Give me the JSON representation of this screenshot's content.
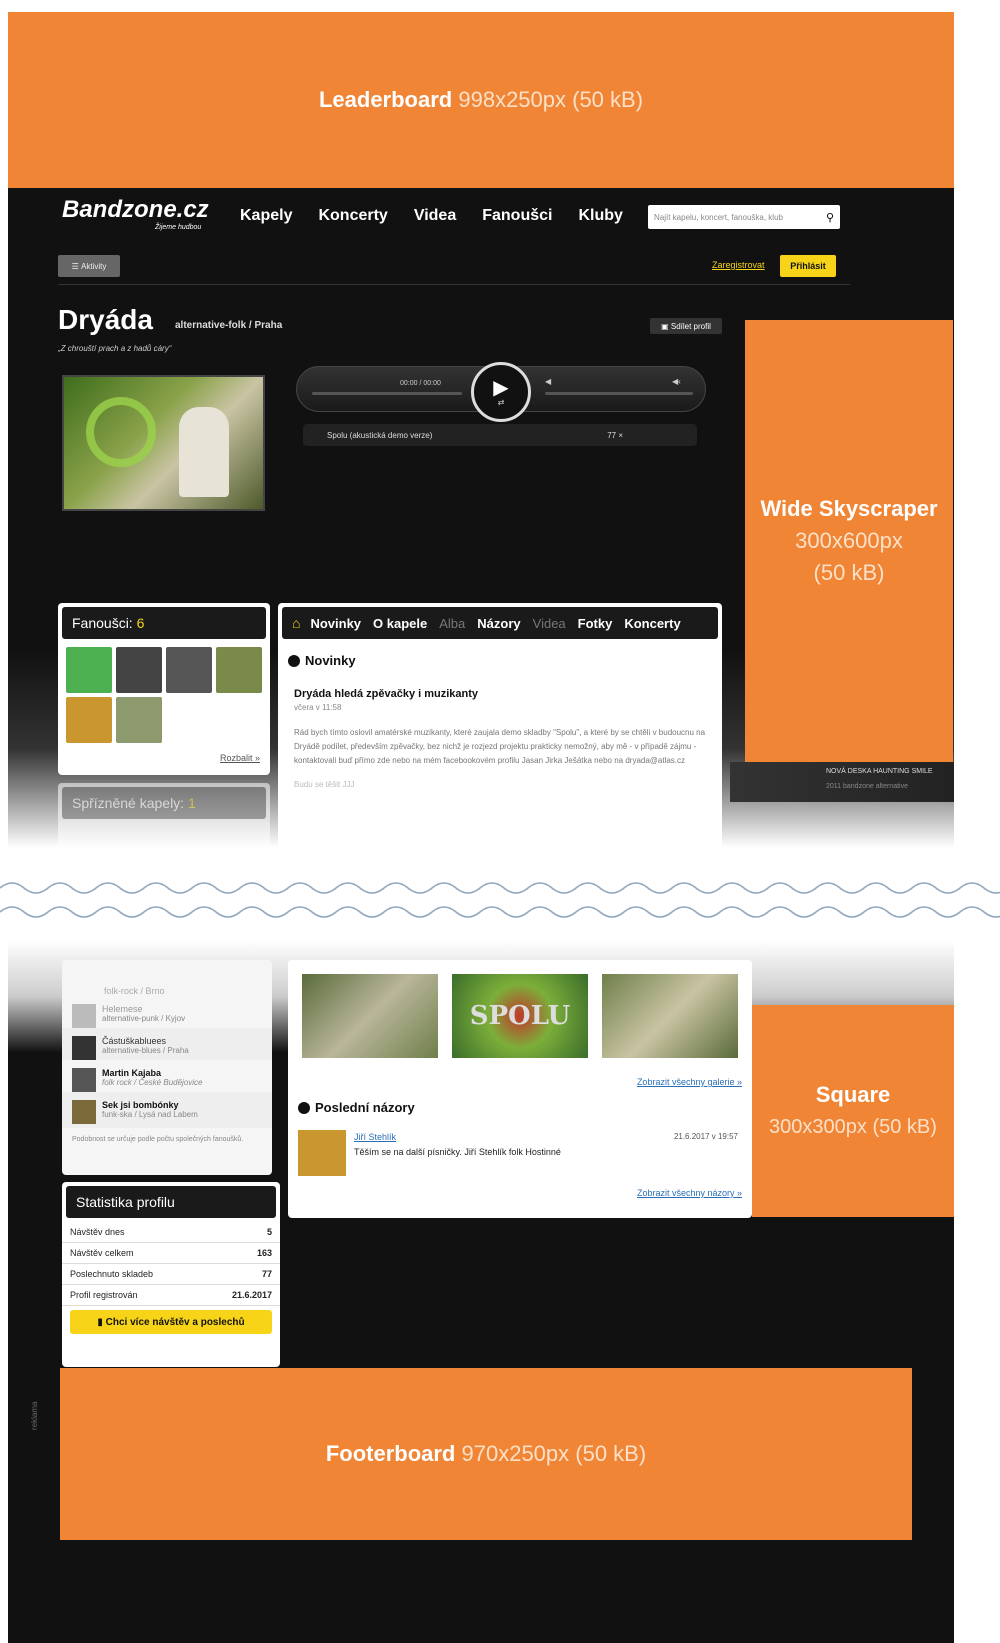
{
  "leaderboard": {
    "name": "Leaderboard",
    "spec": "998x250px (50 kB)"
  },
  "skyscraper": {
    "name": "Wide Skyscraper",
    "spec1": "300x600px",
    "spec2": "(50 kB)"
  },
  "square": {
    "name": "Square",
    "spec": "300x300px (50 kB)"
  },
  "footerboard": {
    "name": "Footerboard",
    "spec": "970x250px (50 kB)"
  },
  "site": {
    "logo": "Bandzone.cz",
    "tagline": "Žijeme hudbou",
    "nav": [
      "Kapely",
      "Koncerty",
      "Videa",
      "Fanoušci",
      "Kluby"
    ],
    "search_placeholder": "Najít kapelu, koncert, fanouška, klub",
    "activity_label": "Aktivity",
    "register": "Zaregistrovat",
    "login": "Přihlásit"
  },
  "band": {
    "name": "Dryáda",
    "genre": "alternative-folk / Praha",
    "quote": "„Z chrouští prach a z hadů cáry“",
    "share": "Sdílet profil",
    "time": "00:00 / 00:00",
    "track": "Spolu (akustická demo verze)",
    "plays": "77 ×"
  },
  "fans": {
    "label": "Fanoušci:",
    "count": "6",
    "more": "Rozbalit »"
  },
  "related": {
    "label": "Spřízněné kapely:",
    "count": "1"
  },
  "tabs": [
    "Novinky",
    "O kapele",
    "Alba",
    "Názory",
    "Videa",
    "Fotky",
    "Koncerty"
  ],
  "news": {
    "heading": "Novinky",
    "title": "Dryáda hledá zpěvačky i muzikanty",
    "date": "včera v 11:58",
    "body": "Rád bych tímto oslovil amatérské muzikanty, které zaujala demo skladby \"Spolu\", a které by se chtěli v budoucnu na Dryádě podílet, především zpěvačky, bez nichž je rozjezd projektu prakticky nemožný, aby mě - v případě zájmu - kontaktovali buď přímo zde nebo na mém facebookovém profilu Jasan Jirka Ješátka nebo na dryada@atlas.cz",
    "sign": "Budu se těšit JJJ"
  },
  "related_list": [
    {
      "name": "Helemese",
      "genre": "alternative-punk / Kyjov"
    },
    {
      "name": "Částuškabluees",
      "genre": "alternative-blues / Praha"
    },
    {
      "name": "Martin Kajaba",
      "genre": "folk rock / České Budějovice"
    },
    {
      "name": "Sek jsi bombónky",
      "genre": "funk-ska / Lysá nad Labem"
    }
  ],
  "related_note": "Podobnost se určuje podle počtu společných fanoušků.",
  "partial_genre": "folk-rock / Brno",
  "stats": {
    "title": "Statistika profilu",
    "rows": [
      {
        "label": "Návštěv dnes",
        "value": "5"
      },
      {
        "label": "Návštěv celkem",
        "value": "163"
      },
      {
        "label": "Poslechnuto skladeb",
        "value": "77"
      },
      {
        "label": "Profil registrován",
        "value": "21.6.2017"
      }
    ],
    "cta": "Chci více návštěv a poslechů"
  },
  "gallery_link": "Zobrazit všechny galerie »",
  "opinions": {
    "heading": "Poslední názory",
    "user": "Jiří Stehlík",
    "date": "21.6.2017 v 19:57",
    "text": "Těším se na další písničky. Jiří Stehlík folk Hostinné",
    "more": "Zobrazit všechny názory »"
  },
  "spolu_text": "SPOLU",
  "ad_strip": "NOVÁ DESKA HAUNTING SMILE",
  "ad_strip2": "2011 bandzone alternative",
  "reklama": "reklama",
  "colors": {
    "orange": "#f08535",
    "yellow": "#f7d418",
    "dark": "#111111"
  }
}
